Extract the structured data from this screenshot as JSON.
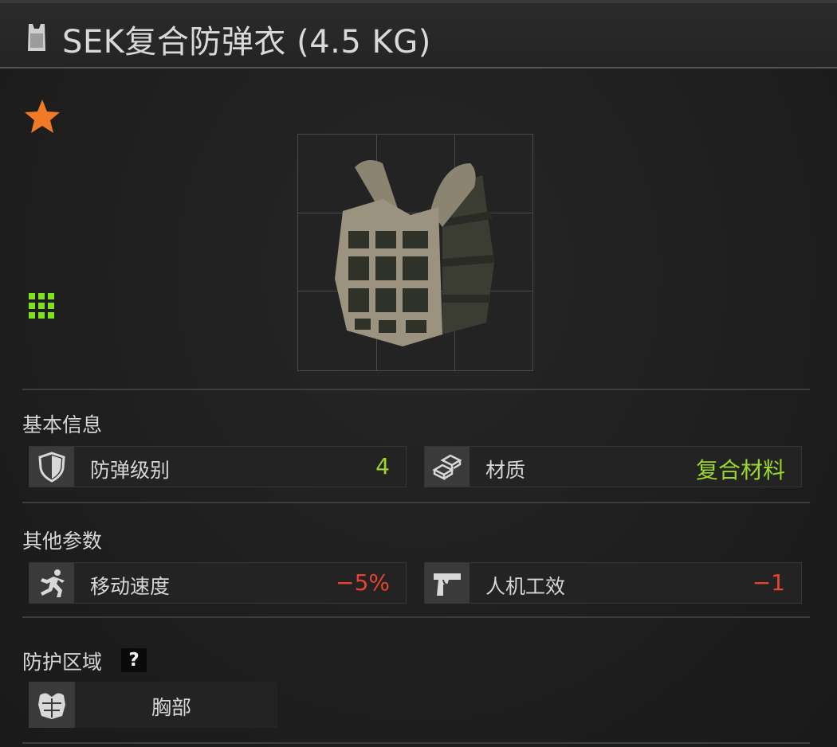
{
  "header": {
    "title": "SEK复合防弹衣 (4.5 KG)",
    "title_icon": "armor-vest-icon"
  },
  "item": {
    "favorite_icon": "star-icon",
    "favorite_color": "#f07a26",
    "grid_icon": "grid-icon",
    "grid_color": "#7fe020",
    "image": "armor-vest-image"
  },
  "basic_info": {
    "title": "基本信息",
    "stats": [
      {
        "label": "防弹级别",
        "value": "4",
        "icon": "shield-icon",
        "value_color": "#9bd62a"
      },
      {
        "label": "材质",
        "value": "复合材料",
        "icon": "material-ingots-icon",
        "value_color": "#9bd62a"
      }
    ]
  },
  "other_params": {
    "title": "其他参数",
    "stats": [
      {
        "label": "移动速度",
        "value": "−5%",
        "icon": "running-man-icon",
        "value_color": "#e8432c"
      },
      {
        "label": "人机工效",
        "value": "−1",
        "icon": "pistol-icon",
        "value_color": "#e8432c"
      }
    ]
  },
  "protection": {
    "title": "防护区域",
    "help_label": "?",
    "zones": [
      {
        "label": "胸部",
        "icon": "chest-armor-icon"
      }
    ]
  }
}
